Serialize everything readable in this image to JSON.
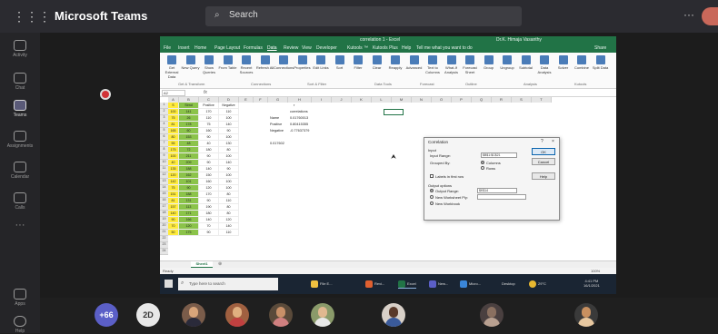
{
  "header": {
    "app_title": "Microsoft Teams",
    "search_placeholder": "Search",
    "more_label": "···"
  },
  "rail": [
    {
      "label": "Activity"
    },
    {
      "label": "Chat"
    },
    {
      "label": "Teams"
    },
    {
      "label": "Assignments"
    },
    {
      "label": "Calendar"
    },
    {
      "label": "Calls"
    },
    {
      "label": "···"
    },
    {
      "label": "Apps"
    },
    {
      "label": "Help"
    }
  ],
  "excel": {
    "title": "correlation 1 - Excel",
    "user": "Dr.K. Himaja Vasanthy",
    "tabs": [
      "File",
      "Insert",
      "Home",
      "Page Layout",
      "Formulas",
      "Data",
      "Review",
      "View",
      "Developer",
      "Kutools ™",
      "Kutools Plus",
      "Help",
      "Tell me what you want to do"
    ],
    "active_tab": "Data",
    "share_label": "Share",
    "ribbon_buttons": [
      "Get External Data",
      "New Query",
      "Show Queries",
      "From Table",
      "Recent Sources",
      "Refresh All",
      "Connections",
      "Properties",
      "Edit Links",
      "Sort",
      "Filter",
      "Clear",
      "Reapply",
      "Advanced",
      "Text to Columns",
      "What-If Analysis",
      "Forecast Sheet",
      "Group",
      "Ungroup",
      "Subtotal",
      "Data Analysis",
      "Solver",
      "Combine",
      "Split Data"
    ],
    "ribbon_groups": [
      "Get & Transform",
      "Connections",
      "Sort & Filter",
      "Data Tools",
      "Forecast",
      "Outline",
      "Analysis",
      "Kutools"
    ],
    "name_box": "A2",
    "fx": "fx",
    "columns": [
      "A",
      "B",
      "C",
      "D",
      "E",
      "F",
      "G",
      "H",
      "I",
      "J",
      "K",
      "L",
      "M",
      "N",
      "O",
      "P",
      "Q",
      "R",
      "S",
      "T"
    ],
    "header_row": [
      "S",
      "Strnd",
      "Positive",
      "Negative"
    ],
    "rows": [
      [
        "100",
        "141",
        "170",
        "110"
      ],
      [
        "75",
        "26",
        "110",
        "100"
      ],
      [
        "81",
        "178",
        "75",
        "140"
      ],
      [
        "165",
        "60",
        "160",
        "90"
      ],
      [
        "80",
        "153",
        "90",
        "100"
      ],
      [
        "55",
        "48",
        "40",
        "130"
      ],
      [
        "175",
        "72",
        "180",
        "80"
      ],
      [
        "100",
        "211",
        "90",
        "100"
      ],
      [
        "40",
        "209",
        "90",
        "140"
      ],
      [
        "135",
        "188",
        "140",
        "90"
      ],
      [
        "120",
        "162",
        "150",
        "100"
      ],
      [
        "142",
        "101",
        "160",
        "100"
      ],
      [
        "75",
        "90",
        "120",
        "100"
      ],
      [
        "151",
        "188",
        "170",
        "80"
      ],
      [
        "81",
        "131",
        "90",
        "110"
      ],
      [
        "157",
        "113",
        "190",
        "80"
      ],
      [
        "140",
        "171",
        "180",
        "80"
      ],
      [
        "90",
        "166",
        "140",
        "120"
      ],
      [
        "70",
        "120",
        "70",
        "140"
      ],
      [
        "50",
        "175",
        "90",
        "110"
      ]
    ],
    "corr_table": {
      "header": "r",
      "subheader": "correlations",
      "labels": [
        "Name",
        "Positive",
        "Negative"
      ],
      "values": [
        "0.01760013",
        "0.80415355",
        "-0.77637379"
      ],
      "extra": "0.017602"
    },
    "sheet_tab": "Sheet1",
    "status": "Ready",
    "zoom": "100%"
  },
  "dialog": {
    "title": "Correlation",
    "help": "?",
    "close": "×",
    "input_section": "Input",
    "input_range_label": "Input Range:",
    "input_range_value": "$B$1:$C$21",
    "grouped_by_label": "Grouped By:",
    "grouped_columns": "Columns",
    "grouped_rows": "Rows",
    "labels_first_row": "Labels in first row",
    "output_section": "Output options",
    "output_range_label": "Output Range:",
    "output_range_value": "$K$14",
    "new_ws_ply": "New Worksheet Ply:",
    "new_workbook": "New Workbook",
    "ok_label": "OK",
    "cancel_label": "Cancel",
    "help_label": "Help"
  },
  "taskbar": {
    "search_placeholder": "Type here to search",
    "apps": [
      "File E...",
      "Revi...",
      "Excel",
      "New...",
      "Micro...",
      "Desktop"
    ],
    "temp": "29°C",
    "time": "4:41 PM",
    "date": "16/1/2021"
  },
  "participants": {
    "overflow_count": "+66",
    "initials": "2D"
  },
  "colors": {
    "teams_dark": "#1f1f1f",
    "excel_green": "#217346",
    "accent": "#5b5fc7",
    "yellow_col": "#ffeb3b",
    "green_col": "#8bc34a"
  }
}
